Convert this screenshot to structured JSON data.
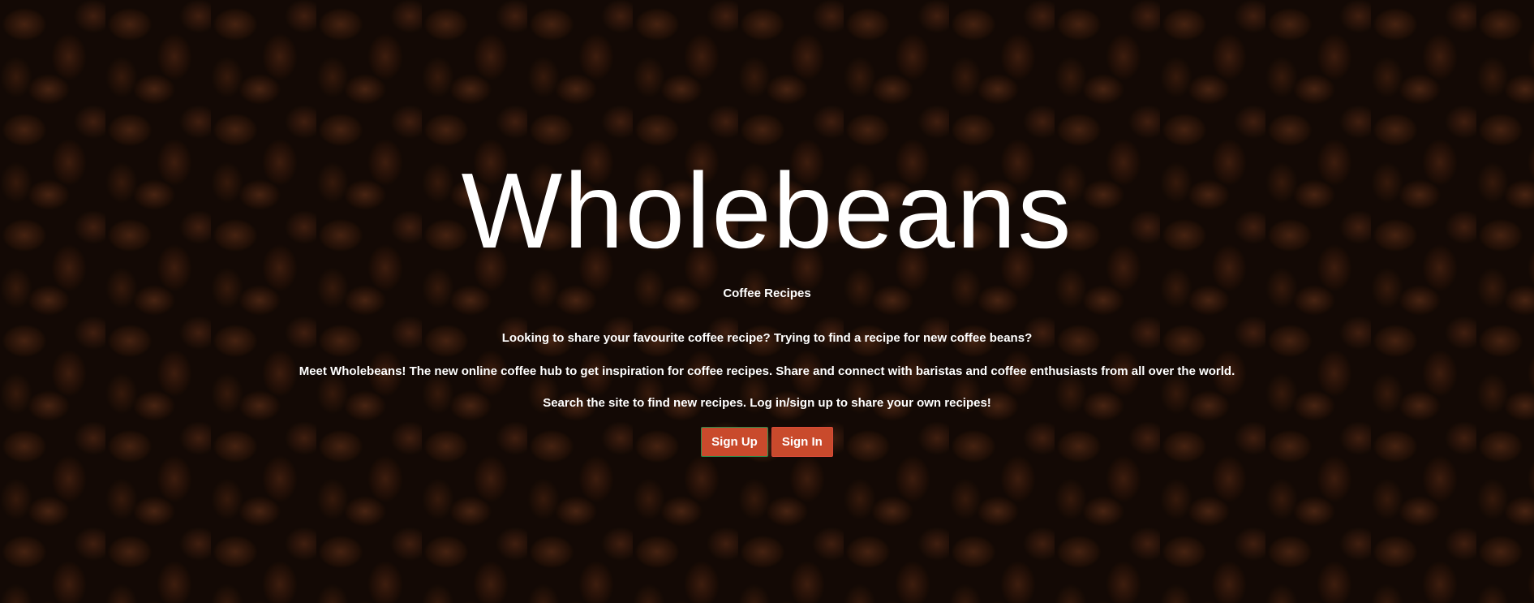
{
  "hero": {
    "title": "Wholebeans",
    "subtitle": "Coffee Recipes",
    "paragraphs": [
      "Looking to share your favourite coffee recipe? Trying to find a recipe for new coffee beans?",
      "Meet Wholebeans! The new online coffee hub to get inspiration for coffee recipes. Share and connect with baristas and coffee enthusiasts from all over the world.",
      "Search the site to find new recipes. Log in/sign up to share your own recipes!"
    ],
    "sign_up_label": "Sign Up",
    "sign_in_label": "Sign In"
  },
  "colors": {
    "button": "#c94a2c",
    "text": "#ffffff"
  }
}
